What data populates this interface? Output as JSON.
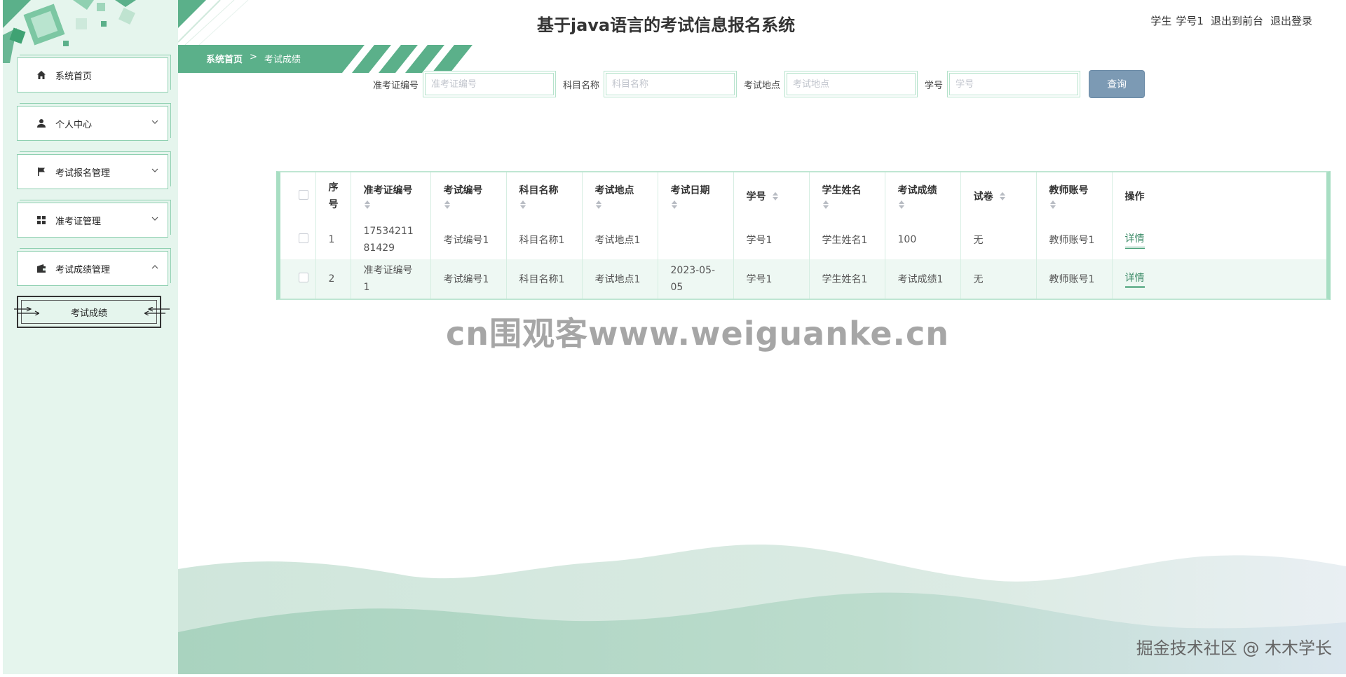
{
  "header": {
    "title": "基于java语言的考试信息报名系统",
    "user_role": "学生",
    "user_name": "学号1",
    "to_frontend": "退出到前台",
    "logout": "退出登录"
  },
  "breadcrumb": {
    "home": "系统首页",
    "separator": ">",
    "current": "考试成绩"
  },
  "sidebar": {
    "items": [
      {
        "label": "系统首页",
        "icon": "home-icon",
        "expandable": false
      },
      {
        "label": "个人中心",
        "icon": "user-icon",
        "expandable": true,
        "expanded": false
      },
      {
        "label": "考试报名管理",
        "icon": "flag-icon",
        "expandable": true,
        "expanded": false
      },
      {
        "label": "准考证管理",
        "icon": "grid-icon",
        "expandable": true,
        "expanded": false
      },
      {
        "label": "考试成绩管理",
        "icon": "wallet-icon",
        "expandable": true,
        "expanded": true
      }
    ],
    "subitem": {
      "label": "考试成绩"
    }
  },
  "search": {
    "fields": [
      {
        "label": "准考证编号",
        "placeholder": "准考证编号",
        "value": ""
      },
      {
        "label": "科目名称",
        "placeholder": "科目名称",
        "value": ""
      },
      {
        "label": "考试地点",
        "placeholder": "考试地点",
        "value": ""
      },
      {
        "label": "学号",
        "placeholder": "学号",
        "value": ""
      }
    ],
    "button_label": "查询"
  },
  "table": {
    "columns": [
      "序号",
      "准考证编号",
      "考试编号",
      "科目名称",
      "考试地点",
      "考试日期",
      "学号",
      "学生姓名",
      "考试成绩",
      "试卷",
      "教师账号",
      "操作"
    ],
    "rows": [
      {
        "index": "1",
        "ticket_no": "1753421181429",
        "exam_no": "考试编号1",
        "subject": "科目名称1",
        "location": "考试地点1",
        "date": "",
        "student_no": "学号1",
        "student_name": "学生姓名1",
        "score": "100",
        "paper": "无",
        "teacher": "教师账号1",
        "action": "详情"
      },
      {
        "index": "2",
        "ticket_no": "准考证编号1",
        "exam_no": "考试编号1",
        "subject": "科目名称1",
        "location": "考试地点1",
        "date": "2023-05-05",
        "student_no": "学号1",
        "student_name": "学生姓名1",
        "score": "考试成绩1",
        "paper": "无",
        "teacher": "教师账号1",
        "action": "详情"
      }
    ]
  },
  "watermark": "cn围观客www.weiguanke.cn",
  "credit": "掘金技术社区 @ 木木学长",
  "colors": {
    "sidebar_bg": "#e5f5ed",
    "accent": "#5bb08a",
    "button": "#7c9ab4",
    "table_border": "#a8dec3",
    "stripe": "#eef8f3"
  }
}
